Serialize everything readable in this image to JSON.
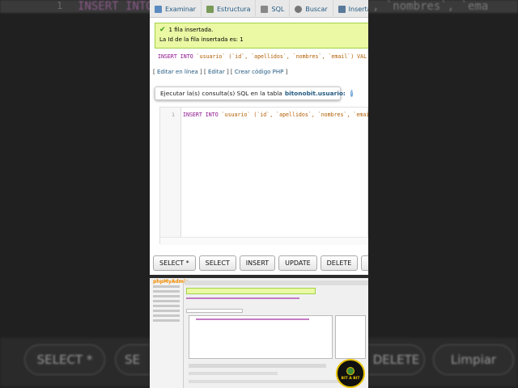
{
  "background": {
    "line_number": "1",
    "code_left": "INSERT INTO",
    "code_right": ", `nombres`, `ema",
    "buttons": [
      "SELECT *",
      "SE",
      "DELETE",
      "Limpiar"
    ]
  },
  "tabs": [
    {
      "label": "Examinar",
      "icon": "browse-icon",
      "color": "#5a8ac0"
    },
    {
      "label": "Estructura",
      "icon": "structure-icon",
      "color": "#7a9a5a"
    },
    {
      "label": "SQL",
      "icon": "sql-icon",
      "color": "#888888"
    },
    {
      "label": "Buscar",
      "icon": "search-icon",
      "color": "#777777"
    },
    {
      "label": "Insertar",
      "icon": "insert-icon",
      "color": "#5a7a9a"
    }
  ],
  "success": {
    "line1": "1 fila insertada.",
    "line2": "La Id de la fila insertada es: 1"
  },
  "query": {
    "kw": "INSERT INTO ",
    "table": "`usuario`",
    "cols": " (`id`, `apellidos`, `nombres`, `email`) VAL"
  },
  "links": {
    "edit_inline": "Editar en línea",
    "edit": "Editar",
    "php": "Crear código PHP"
  },
  "exec": {
    "label": "Ejecutar la(s) consulta(s) SQL en la tabla",
    "table": "bitonobit.usuario:"
  },
  "editor": {
    "line_number": "1",
    "kw": "INSERT INTO ",
    "table": "`usuario`",
    "cols": " (`id`, `apellidos`, `nombres`, `emai"
  },
  "buttons": [
    "SELECT *",
    "SELECT",
    "INSERT",
    "UPDATE",
    "DELETE",
    "Limpiar"
  ],
  "lower": {
    "logo": "phpMyAdmin"
  },
  "badge": {
    "text": "BIT A BIT"
  }
}
